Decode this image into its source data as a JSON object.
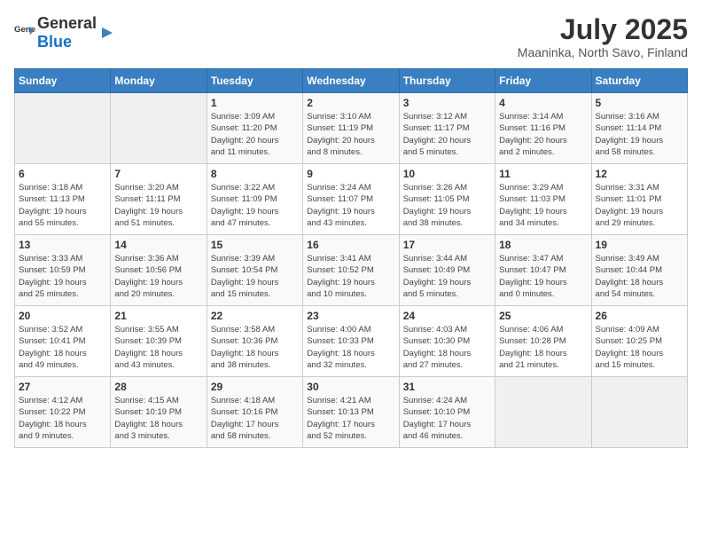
{
  "logo": {
    "general": "General",
    "blue": "Blue"
  },
  "title": "July 2025",
  "subtitle": "Maaninka, North Savo, Finland",
  "days_header": [
    "Sunday",
    "Monday",
    "Tuesday",
    "Wednesday",
    "Thursday",
    "Friday",
    "Saturday"
  ],
  "weeks": [
    [
      {
        "day": "",
        "detail": ""
      },
      {
        "day": "",
        "detail": ""
      },
      {
        "day": "1",
        "detail": "Sunrise: 3:09 AM\nSunset: 11:20 PM\nDaylight: 20 hours\nand 11 minutes."
      },
      {
        "day": "2",
        "detail": "Sunrise: 3:10 AM\nSunset: 11:19 PM\nDaylight: 20 hours\nand 8 minutes."
      },
      {
        "day": "3",
        "detail": "Sunrise: 3:12 AM\nSunset: 11:17 PM\nDaylight: 20 hours\nand 5 minutes."
      },
      {
        "day": "4",
        "detail": "Sunrise: 3:14 AM\nSunset: 11:16 PM\nDaylight: 20 hours\nand 2 minutes."
      },
      {
        "day": "5",
        "detail": "Sunrise: 3:16 AM\nSunset: 11:14 PM\nDaylight: 19 hours\nand 58 minutes."
      }
    ],
    [
      {
        "day": "6",
        "detail": "Sunrise: 3:18 AM\nSunset: 11:13 PM\nDaylight: 19 hours\nand 55 minutes."
      },
      {
        "day": "7",
        "detail": "Sunrise: 3:20 AM\nSunset: 11:11 PM\nDaylight: 19 hours\nand 51 minutes."
      },
      {
        "day": "8",
        "detail": "Sunrise: 3:22 AM\nSunset: 11:09 PM\nDaylight: 19 hours\nand 47 minutes."
      },
      {
        "day": "9",
        "detail": "Sunrise: 3:24 AM\nSunset: 11:07 PM\nDaylight: 19 hours\nand 43 minutes."
      },
      {
        "day": "10",
        "detail": "Sunrise: 3:26 AM\nSunset: 11:05 PM\nDaylight: 19 hours\nand 38 minutes."
      },
      {
        "day": "11",
        "detail": "Sunrise: 3:29 AM\nSunset: 11:03 PM\nDaylight: 19 hours\nand 34 minutes."
      },
      {
        "day": "12",
        "detail": "Sunrise: 3:31 AM\nSunset: 11:01 PM\nDaylight: 19 hours\nand 29 minutes."
      }
    ],
    [
      {
        "day": "13",
        "detail": "Sunrise: 3:33 AM\nSunset: 10:59 PM\nDaylight: 19 hours\nand 25 minutes."
      },
      {
        "day": "14",
        "detail": "Sunrise: 3:36 AM\nSunset: 10:56 PM\nDaylight: 19 hours\nand 20 minutes."
      },
      {
        "day": "15",
        "detail": "Sunrise: 3:39 AM\nSunset: 10:54 PM\nDaylight: 19 hours\nand 15 minutes."
      },
      {
        "day": "16",
        "detail": "Sunrise: 3:41 AM\nSunset: 10:52 PM\nDaylight: 19 hours\nand 10 minutes."
      },
      {
        "day": "17",
        "detail": "Sunrise: 3:44 AM\nSunset: 10:49 PM\nDaylight: 19 hours\nand 5 minutes."
      },
      {
        "day": "18",
        "detail": "Sunrise: 3:47 AM\nSunset: 10:47 PM\nDaylight: 19 hours\nand 0 minutes."
      },
      {
        "day": "19",
        "detail": "Sunrise: 3:49 AM\nSunset: 10:44 PM\nDaylight: 18 hours\nand 54 minutes."
      }
    ],
    [
      {
        "day": "20",
        "detail": "Sunrise: 3:52 AM\nSunset: 10:41 PM\nDaylight: 18 hours\nand 49 minutes."
      },
      {
        "day": "21",
        "detail": "Sunrise: 3:55 AM\nSunset: 10:39 PM\nDaylight: 18 hours\nand 43 minutes."
      },
      {
        "day": "22",
        "detail": "Sunrise: 3:58 AM\nSunset: 10:36 PM\nDaylight: 18 hours\nand 38 minutes."
      },
      {
        "day": "23",
        "detail": "Sunrise: 4:00 AM\nSunset: 10:33 PM\nDaylight: 18 hours\nand 32 minutes."
      },
      {
        "day": "24",
        "detail": "Sunrise: 4:03 AM\nSunset: 10:30 PM\nDaylight: 18 hours\nand 27 minutes."
      },
      {
        "day": "25",
        "detail": "Sunrise: 4:06 AM\nSunset: 10:28 PM\nDaylight: 18 hours\nand 21 minutes."
      },
      {
        "day": "26",
        "detail": "Sunrise: 4:09 AM\nSunset: 10:25 PM\nDaylight: 18 hours\nand 15 minutes."
      }
    ],
    [
      {
        "day": "27",
        "detail": "Sunrise: 4:12 AM\nSunset: 10:22 PM\nDaylight: 18 hours\nand 9 minutes."
      },
      {
        "day": "28",
        "detail": "Sunrise: 4:15 AM\nSunset: 10:19 PM\nDaylight: 18 hours\nand 3 minutes."
      },
      {
        "day": "29",
        "detail": "Sunrise: 4:18 AM\nSunset: 10:16 PM\nDaylight: 17 hours\nand 58 minutes."
      },
      {
        "day": "30",
        "detail": "Sunrise: 4:21 AM\nSunset: 10:13 PM\nDaylight: 17 hours\nand 52 minutes."
      },
      {
        "day": "31",
        "detail": "Sunrise: 4:24 AM\nSunset: 10:10 PM\nDaylight: 17 hours\nand 46 minutes."
      },
      {
        "day": "",
        "detail": ""
      },
      {
        "day": "",
        "detail": ""
      }
    ]
  ]
}
